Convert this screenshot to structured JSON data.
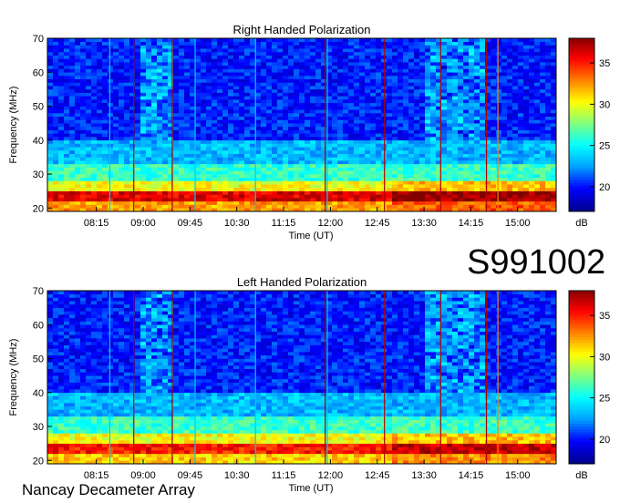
{
  "page_id": "S991002",
  "footer_text": "Nancay Decameter Array",
  "chart_data": [
    {
      "type": "heatmap",
      "title": "Right Handed Polarization",
      "xlabel": "Time (UT)",
      "ylabel": "Frequency (MHz)",
      "x_ticks": [
        "08:15",
        "09:00",
        "09:45",
        "10:30",
        "11:15",
        "12:00",
        "12:45",
        "13:30",
        "14:15",
        "15:00"
      ],
      "x_tick_minutes": [
        495,
        540,
        585,
        630,
        675,
        720,
        765,
        810,
        855,
        900
      ],
      "xlim_minutes": [
        448,
        937
      ],
      "ylim": [
        19,
        70
      ],
      "y_ticks": [
        20,
        30,
        40,
        50,
        60,
        70
      ],
      "colorbar": {
        "label": "dB",
        "range": [
          17,
          38
        ],
        "ticks": [
          20,
          25,
          30,
          35
        ]
      },
      "colormap": [
        "#00008f",
        "#0000ff",
        "#00a0ff",
        "#00ffff",
        "#80ff80",
        "#ffff00",
        "#ff8000",
        "#ff0000",
        "#800000"
      ],
      "vertical_markers_minutes": [
        {
          "t": 508,
          "color": "#00c8ff"
        },
        {
          "t": 531,
          "color": "#b00000"
        },
        {
          "t": 568,
          "color": "#a00000"
        },
        {
          "t": 590,
          "color": "#00c8ff"
        },
        {
          "t": 648,
          "color": "#00c8ff"
        },
        {
          "t": 715,
          "color": "#a00000"
        },
        {
          "t": 717,
          "color": "#00c8ff"
        },
        {
          "t": 772,
          "color": "#b00000"
        },
        {
          "t": 826,
          "color": "#b00000"
        },
        {
          "t": 870,
          "color": "#b00000"
        },
        {
          "t": 881,
          "color": "#ff8000"
        }
      ],
      "emission_bands_mhz": [
        {
          "range": [
            19,
            22
          ],
          "level": 32
        },
        {
          "range": [
            22,
            25
          ],
          "level": 36
        },
        {
          "range": [
            25,
            28
          ],
          "level": 30
        },
        {
          "range": [
            28,
            33
          ],
          "level": 26
        },
        {
          "range": [
            33,
            40
          ],
          "level": 23
        },
        {
          "range": [
            40,
            70
          ],
          "level": 20
        }
      ]
    },
    {
      "type": "heatmap",
      "title": "Left Handed Polarization",
      "xlabel": "Time (UT)",
      "ylabel": "Frequency (MHz)",
      "x_ticks": [
        "08:15",
        "09:00",
        "09:45",
        "10:30",
        "11:15",
        "12:00",
        "12:45",
        "13:30",
        "14:15",
        "15:00"
      ],
      "x_tick_minutes": [
        495,
        540,
        585,
        630,
        675,
        720,
        765,
        810,
        855,
        900
      ],
      "xlim_minutes": [
        448,
        937
      ],
      "ylim": [
        19,
        70
      ],
      "y_ticks": [
        20,
        30,
        40,
        50,
        60,
        70
      ],
      "colorbar": {
        "label": "dB",
        "range": [
          17,
          38
        ],
        "ticks": [
          20,
          25,
          30,
          35
        ]
      },
      "colormap": [
        "#00008f",
        "#0000ff",
        "#00a0ff",
        "#00ffff",
        "#80ff80",
        "#ffff00",
        "#ff8000",
        "#ff0000",
        "#800000"
      ],
      "vertical_markers_minutes": [
        {
          "t": 508,
          "color": "#00c8ff"
        },
        {
          "t": 531,
          "color": "#b00000"
        },
        {
          "t": 568,
          "color": "#a00000"
        },
        {
          "t": 590,
          "color": "#00c8ff"
        },
        {
          "t": 648,
          "color": "#00c8ff"
        },
        {
          "t": 715,
          "color": "#a00000"
        },
        {
          "t": 717,
          "color": "#00c8ff"
        },
        {
          "t": 772,
          "color": "#b00000"
        },
        {
          "t": 826,
          "color": "#b00000"
        },
        {
          "t": 870,
          "color": "#b00000"
        },
        {
          "t": 881,
          "color": "#ff8000"
        }
      ],
      "emission_bands_mhz": [
        {
          "range": [
            19,
            22
          ],
          "level": 31
        },
        {
          "range": [
            22,
            25
          ],
          "level": 35
        },
        {
          "range": [
            25,
            28
          ],
          "level": 30
        },
        {
          "range": [
            28,
            33
          ],
          "level": 26
        },
        {
          "range": [
            33,
            40
          ],
          "level": 23
        },
        {
          "range": [
            40,
            70
          ],
          "level": 20
        }
      ]
    }
  ]
}
